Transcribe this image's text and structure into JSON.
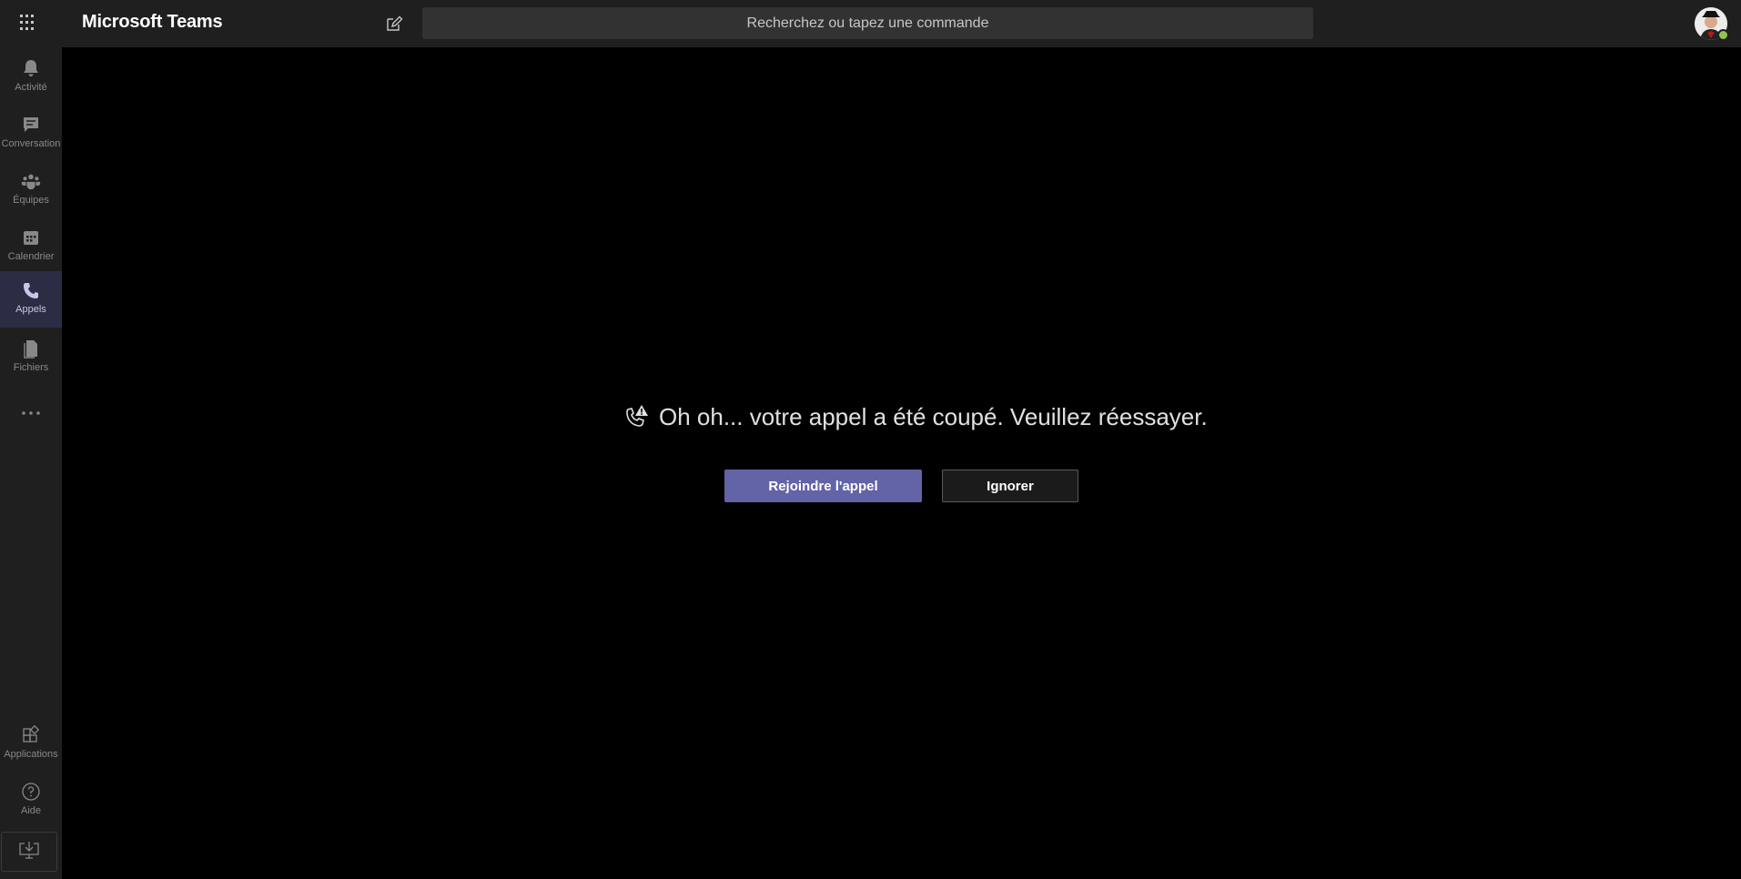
{
  "header": {
    "app_title": "Microsoft Teams",
    "search_placeholder": "Recherchez ou tapez une commande",
    "app_launcher_icon": "waffle-grid-icon",
    "compose_icon": "compose-icon",
    "avatar_presence": "available",
    "presence_color": "#92c353"
  },
  "rail": {
    "items": [
      {
        "label": "Activité",
        "icon": "bell-icon"
      },
      {
        "label": "Conversation",
        "icon": "chat-icon"
      },
      {
        "label": "Équipes",
        "icon": "teams-icon"
      },
      {
        "label": "Calendrier",
        "icon": "calendar-icon"
      },
      {
        "label": "Appels",
        "icon": "phone-icon",
        "active": true
      },
      {
        "label": "Fichiers",
        "icon": "file-icon"
      }
    ],
    "more_icon": "more-dots-icon",
    "bottom_items": [
      {
        "label": "Applications",
        "icon": "apps-icon"
      },
      {
        "label": "Aide",
        "icon": "help-icon"
      }
    ],
    "download_icon": "download-icon"
  },
  "main": {
    "message": "Oh oh... votre appel a été coupé. Veuillez réessayer.",
    "message_icon": "call-warning-icon",
    "rejoin_label": "Rejoindre l'appel",
    "dismiss_label": "Ignorer"
  },
  "colors": {
    "accent": "#6264a7",
    "rail_background": "#201f1f",
    "main_background": "#000000"
  }
}
